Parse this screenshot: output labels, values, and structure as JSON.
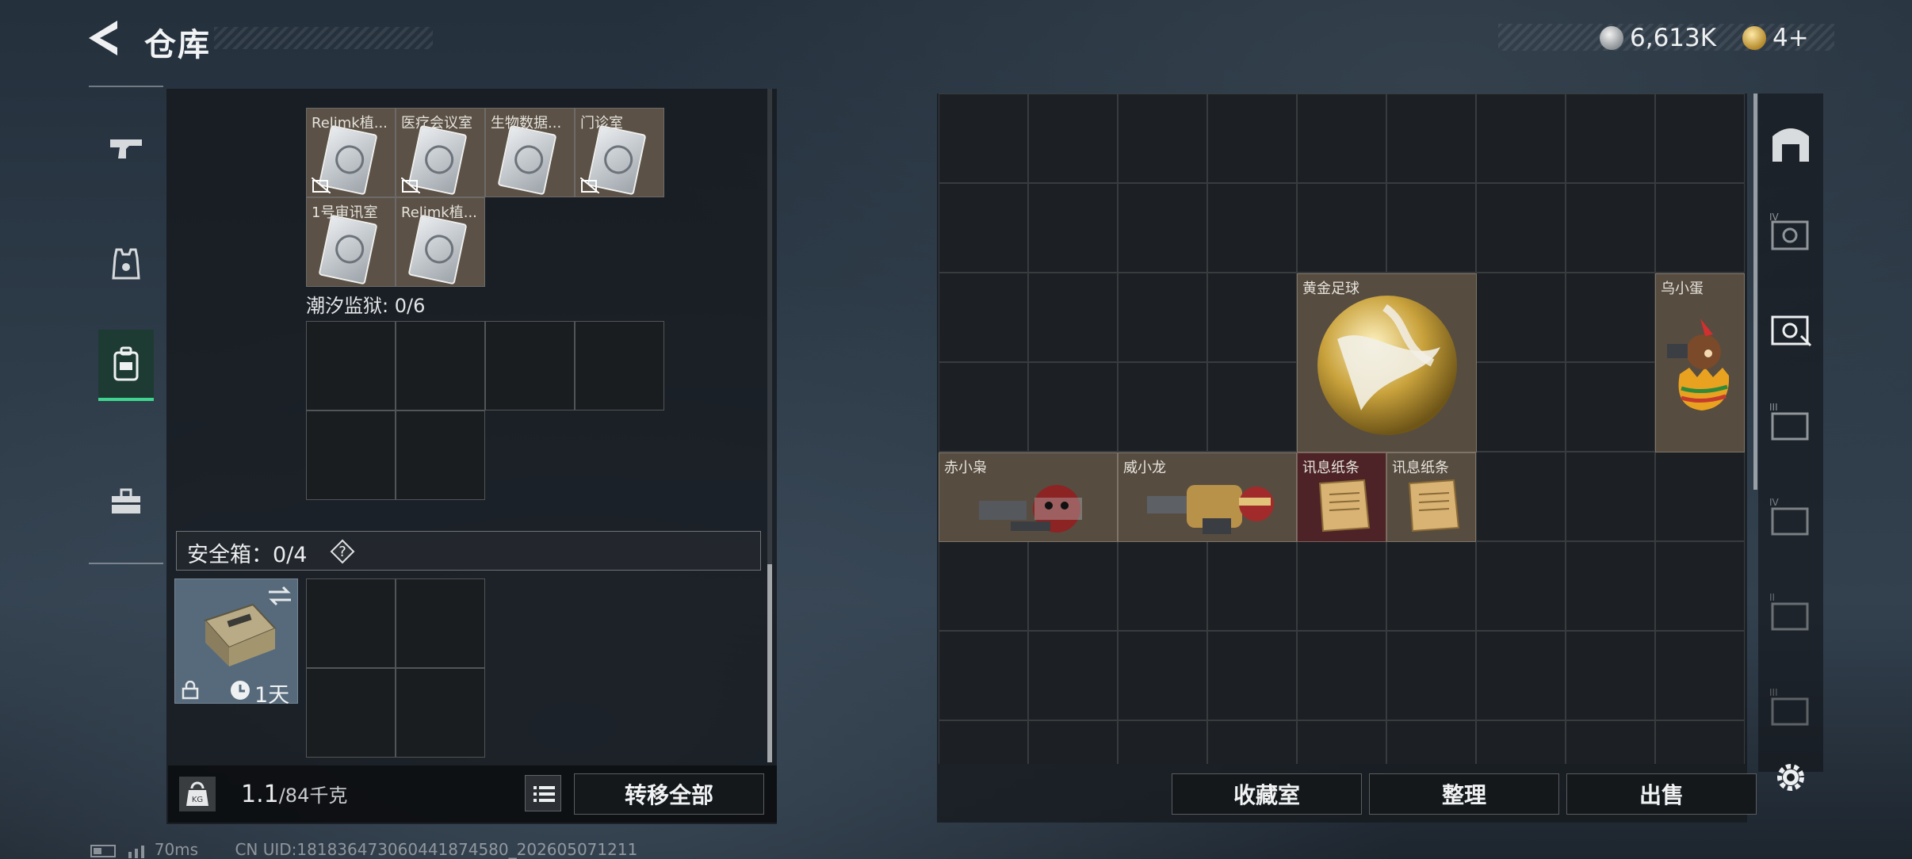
{
  "header": {
    "title": "仓库",
    "currency_silver": "6,613K",
    "currency_gold": "4+"
  },
  "left_nav": {
    "items": [
      "weapons",
      "armor",
      "backpack",
      "toolbox"
    ],
    "active": "backpack"
  },
  "left_panel": {
    "items": [
      {
        "label": "Relimk植..."
      },
      {
        "label": "医疗会议室"
      },
      {
        "label": "生物数据..."
      },
      {
        "label": "门诊室"
      },
      {
        "label": "1号审讯室"
      },
      {
        "label": "Relimk植..."
      }
    ],
    "section_tide_prison": "潮汐监狱: 0/6",
    "safe_box": {
      "label": "安全箱：0/4",
      "help": "?",
      "timer": "1天"
    },
    "weight": {
      "current": "1.1",
      "max": "/84千克"
    },
    "transfer_all": "转移全部"
  },
  "right_panel": {
    "items": [
      {
        "label": "黄金足球"
      },
      {
        "label": "乌小蛋"
      },
      {
        "label": "赤小枭"
      },
      {
        "label": "威小龙"
      },
      {
        "label": "讯息纸条"
      },
      {
        "label": "讯息纸条"
      }
    ],
    "buttons": {
      "collection": "收藏室",
      "sort": "整理",
      "sell": "出售"
    }
  },
  "footer": {
    "ping": "70ms",
    "uid": "CN UID:18183647306044187458​0_202605071211"
  },
  "colors": {
    "accent_green": "#3ed68f",
    "item_tan": "#574c40",
    "item_red": "#4d2327"
  }
}
